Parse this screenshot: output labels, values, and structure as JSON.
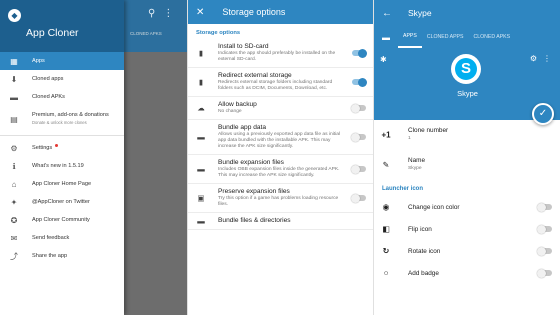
{
  "theme": {
    "primary": "#2e86c1",
    "primary_dark": "#1d5f8e",
    "skype_blue": "#00aff0",
    "accent_red": "#e53935"
  },
  "panel1": {
    "app_title": "App Cloner",
    "scrim_tab_text": "CLONED APKS",
    "items": [
      {
        "icon": "apps-grid-icon",
        "glyph": "▦",
        "label": "Apps",
        "active": true
      },
      {
        "icon": "download-icon",
        "glyph": "⬇",
        "label": "Cloned apps"
      },
      {
        "icon": "folder-icon",
        "glyph": "▬",
        "label": "Cloned APKs"
      },
      {
        "icon": "shop-icon",
        "glyph": "▤",
        "label": "Premium, add-ons & donations",
        "sub": "Donate & unlock more clones"
      }
    ],
    "items2": [
      {
        "icon": "gear-icon",
        "glyph": "⚙",
        "label": "Settings",
        "dot": true
      },
      {
        "icon": "info-icon",
        "glyph": "ℹ",
        "label": "What's new in 1.5.19"
      },
      {
        "icon": "home-icon",
        "glyph": "⌂",
        "label": "App Cloner Home Page"
      },
      {
        "icon": "twitter-icon",
        "glyph": "✦",
        "label": "@AppCloner on Twitter"
      },
      {
        "icon": "community-icon",
        "glyph": "✪",
        "label": "App Cloner Community"
      },
      {
        "icon": "feedback-icon",
        "glyph": "✉",
        "label": "Send feedback"
      },
      {
        "icon": "share-icon",
        "glyph": "⤴",
        "label": "Share the app"
      }
    ]
  },
  "panel2": {
    "title": "Storage options",
    "section": "Storage options",
    "options": [
      {
        "icon": "sd-card-icon",
        "glyph": "▮",
        "title": "Install to SD-card",
        "desc": "Indicates the app should preferably be installed on the external SD-card.",
        "on": true
      },
      {
        "icon": "sd-card-icon",
        "glyph": "▮",
        "title": "Redirect external storage",
        "desc": "Redirects external storage folders including standard folders such as DCIM, Documents, Download, etc.",
        "on": true
      },
      {
        "icon": "cloud-upload-icon",
        "glyph": "☁",
        "title": "Allow backup",
        "desc": "No change",
        "on": false
      },
      {
        "icon": "folder-icon",
        "glyph": "▬",
        "title": "Bundle app data",
        "desc": "Allows using a previously exported app data file as initial app data bundled with the installable APK. This may increase the APK size significantly.",
        "on": false
      },
      {
        "icon": "folder-icon",
        "glyph": "▬",
        "title": "Bundle expansion files",
        "desc": "Includes OBB expansion files inside the generated APK. This may increase the APK size significantly.",
        "on": false
      },
      {
        "icon": "archive-icon",
        "glyph": "▣",
        "title": "Preserve expansion files",
        "desc": "Try this option if a game has problems loading resource files.",
        "on": false
      },
      {
        "icon": "folder-icon",
        "glyph": "▬",
        "title": "Bundle files & directories",
        "desc": "",
        "on": false
      }
    ]
  },
  "panel3": {
    "title": "Skype",
    "tabs": [
      "APPS",
      "CLONED APPS",
      "CLONED APKS"
    ],
    "app_name": "Skype",
    "logo_letter": "S",
    "clone_number_label": "Clone number",
    "clone_number_value": "1",
    "clone_number_icon": "+1",
    "name_label": "Name",
    "name_value": "Skype",
    "section": "Launcher icon",
    "options": [
      {
        "icon": "palette-icon",
        "glyph": "◉",
        "label": "Change icon color",
        "on": false
      },
      {
        "icon": "flip-icon",
        "glyph": "◧",
        "label": "Flip icon",
        "on": false
      },
      {
        "icon": "rotate-icon",
        "glyph": "↻",
        "label": "Rotate icon",
        "on": false
      },
      {
        "icon": "badge-icon",
        "glyph": "○",
        "label": "Add badge",
        "on": false
      }
    ]
  }
}
